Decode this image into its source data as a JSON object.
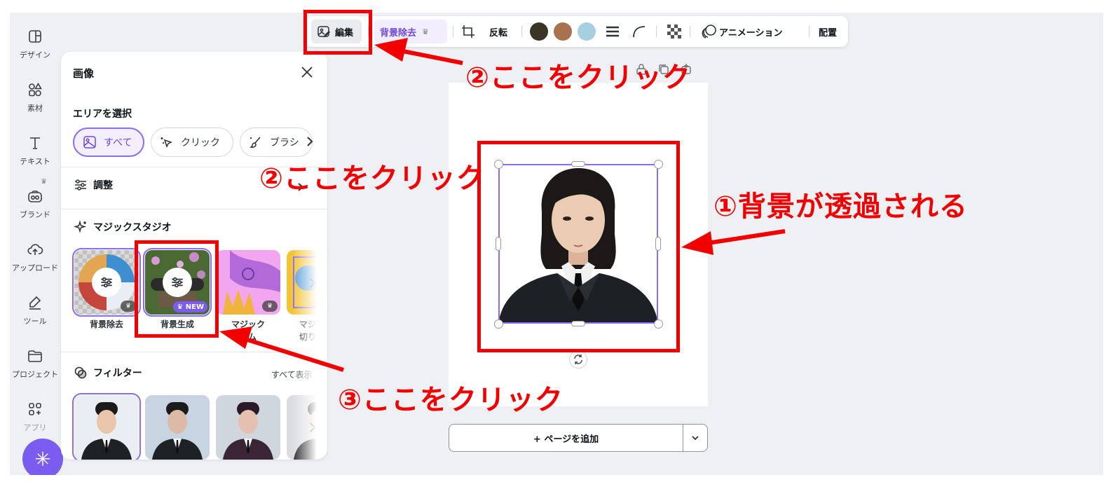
{
  "rail": {
    "items": [
      {
        "label": "デザイン"
      },
      {
        "label": "素材"
      },
      {
        "label": "テキスト"
      },
      {
        "label": "ブランド"
      },
      {
        "label": "アップロード"
      },
      {
        "label": "ツール"
      },
      {
        "label": "プロジェクト"
      },
      {
        "label": "アプリ"
      }
    ]
  },
  "panel": {
    "title": "画像",
    "area_title": "エリアを選択",
    "chips": [
      {
        "label": "すべて"
      },
      {
        "label": "クリック"
      },
      {
        "label": "ブラシ"
      }
    ],
    "adjust_label": "調整",
    "magic_title": "マジックスタジオ",
    "tiles": [
      {
        "label": "背景除去"
      },
      {
        "label": "背景生成",
        "badge": "NEW"
      },
      {
        "label": "マジック",
        "label2": "ゴム"
      },
      {
        "label": "マジ",
        "label2": "切り"
      }
    ],
    "filter_title": "フィルター",
    "see_all": "すべて表示"
  },
  "toolbar": {
    "edit_label": "編集",
    "bg_remove_label": "背景除去",
    "flip_label": "反転",
    "animation_label": "アニメーション",
    "arrange_label": "配置",
    "swatches": [
      "#3b3527",
      "#a8724e",
      "#a5d0e0"
    ]
  },
  "canvas": {
    "add_page_label": "+ ページを追加"
  },
  "annotations": {
    "step2_top": "②ここをクリック",
    "step2_mid": "②ここをクリック",
    "step1": "①背景が透過される",
    "step3": "③ここをクリック",
    "color": "#f20000"
  },
  "colors": {
    "accent": "#8b6cf6",
    "canvas_bg": "#eef0f3"
  }
}
